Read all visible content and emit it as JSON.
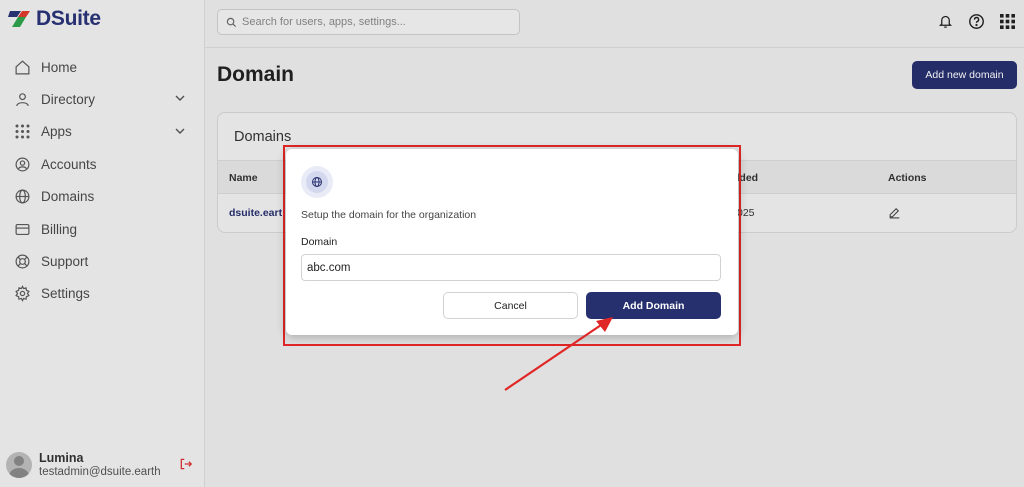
{
  "app": {
    "name": "DSuite"
  },
  "sidebar": {
    "items": [
      {
        "label": "Home",
        "icon": "home-icon"
      },
      {
        "label": "Directory",
        "icon": "user-icon",
        "expandable": true
      },
      {
        "label": "Apps",
        "icon": "grid-icon",
        "expandable": true
      },
      {
        "label": "Accounts",
        "icon": "account-circle-icon"
      },
      {
        "label": "Domains",
        "icon": "globe-icon"
      },
      {
        "label": "Billing",
        "icon": "credit-card-icon"
      },
      {
        "label": "Support",
        "icon": "lifebuoy-icon"
      },
      {
        "label": "Settings",
        "icon": "gear-icon"
      }
    ],
    "user": {
      "name": "Lumina",
      "email": "testadmin@dsuite.earth"
    }
  },
  "topbar": {
    "search_placeholder": "Search for users, apps, settings..."
  },
  "page": {
    "title": "Domain",
    "add_button": "Add new domain"
  },
  "card": {
    "title": "Domains",
    "columns": [
      "Name",
      "dded",
      "Actions"
    ],
    "rows": [
      {
        "name": "dsuite.eart",
        "added": "025"
      }
    ]
  },
  "modal": {
    "description": "Setup the domain for the organization",
    "field_label": "Domain",
    "field_value": "abc.com",
    "cancel_label": "Cancel",
    "submit_label": "Add Domain"
  },
  "colors": {
    "brand": "#27306f",
    "highlight": "#e02727"
  }
}
